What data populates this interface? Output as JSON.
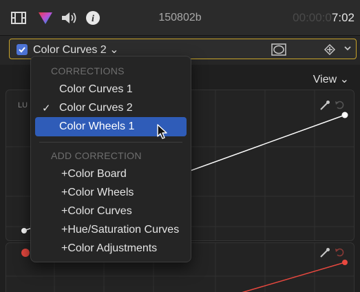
{
  "topbar": {
    "icons": [
      "filmstrip-icon",
      "color-prism-icon",
      "speaker-icon",
      "info-icon"
    ],
    "clip_name": "150802b",
    "timecode_dim": "00:00:0",
    "timecode_lit": "7:02"
  },
  "selector": {
    "checked": true,
    "label": "Color Curves 2 ⌄",
    "accent": "#c9a42a",
    "checkbox_color": "#4d74d6"
  },
  "view": {
    "label": "View ⌄"
  },
  "panel": {
    "luma_label": "LU"
  },
  "menu": {
    "corrections_heading": "CORRECTIONS",
    "corrections": [
      {
        "label": "Color Curves 1",
        "checked": false,
        "highlighted": false
      },
      {
        "label": "Color Curves 2",
        "checked": true,
        "highlighted": false
      },
      {
        "label": "Color Wheels 1",
        "checked": false,
        "highlighted": true
      }
    ],
    "check_glyph": "✓",
    "add_heading": "ADD CORRECTION",
    "add_items": [
      "+Color Board",
      "+Color Wheels",
      "+Color Curves",
      "+Hue/Saturation Curves",
      "+Color Adjustments"
    ],
    "highlight_color": "#2f5cb8"
  },
  "curves": {
    "luma_color": "#ffffff",
    "red_color": "#e8483f"
  }
}
